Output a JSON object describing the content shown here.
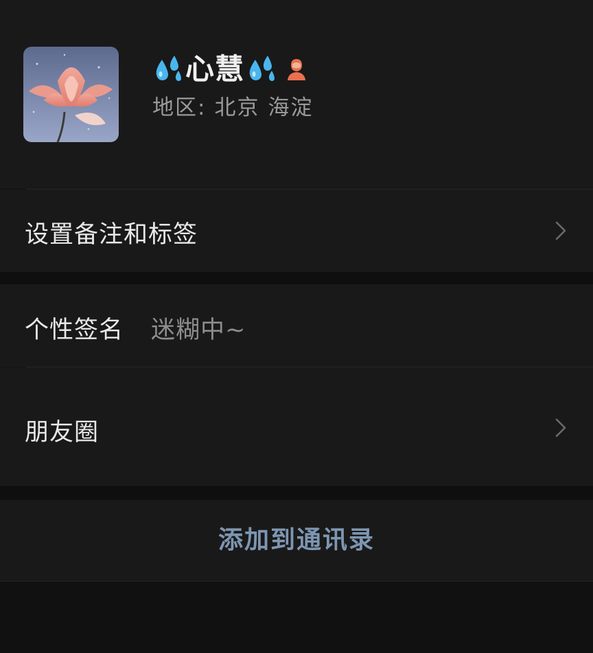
{
  "profile": {
    "name": "心慧",
    "name_prefix_icon": "sweat-droplets-icon",
    "name_suffix_icon": "sweat-droplets-icon",
    "gender_icon": "female-person-icon",
    "region_label": "地区:",
    "region_city": "北京",
    "region_district": "海淀"
  },
  "rows": {
    "remark_label": "设置备注和标签",
    "signature_label": "个性签名",
    "signature_value": "迷糊中~",
    "moments_label": "朋友圈"
  },
  "actions": {
    "add_contact": "添加到通讯录"
  },
  "colors": {
    "background": "#111111",
    "surface": "#191919",
    "link_blue": "#7d96b2",
    "droplet_blue": "#49b6ee",
    "gender_orange": "#e9714f"
  }
}
